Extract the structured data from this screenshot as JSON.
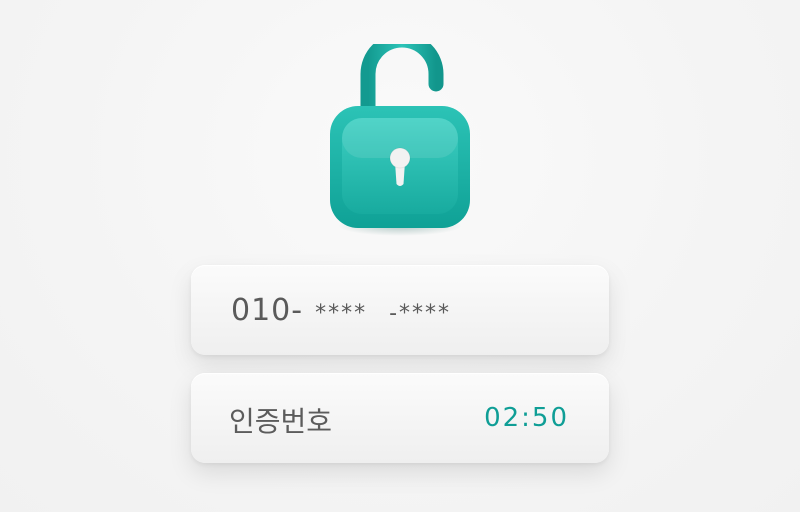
{
  "lock": {
    "icon": "unlocked-padlock-icon",
    "color": "#1bb3a7"
  },
  "phone": {
    "prefix": "010-",
    "middle": "****",
    "last": "-****"
  },
  "verification": {
    "label": "인증번호",
    "timer": "02:50",
    "timer_color": "#0f9e96"
  }
}
